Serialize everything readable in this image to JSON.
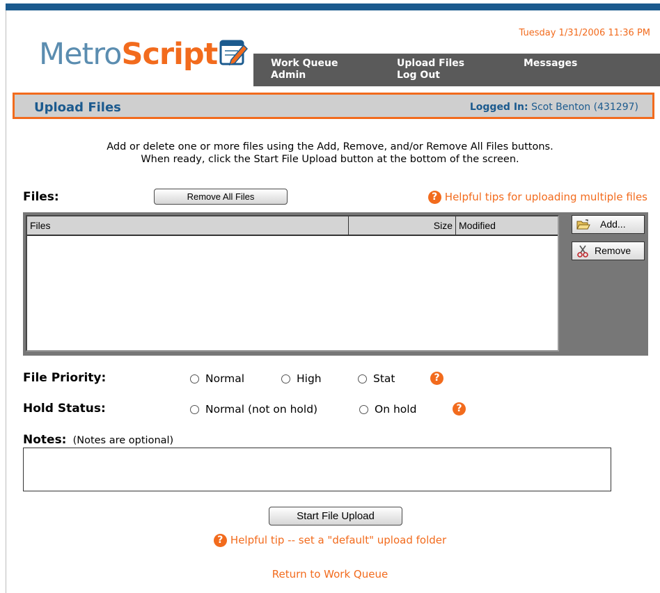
{
  "header": {
    "logo_part1": "Metro",
    "logo_part2": "Script",
    "datetime": "Tuesday 1/31/2006 11:36 PM"
  },
  "nav": {
    "work_queue": "Work Queue",
    "admin": "Admin",
    "upload_files": "Upload Files",
    "log_out": "Log Out",
    "messages": "Messages"
  },
  "page": {
    "title": "Upload Files",
    "logged_in_label": "Logged In:",
    "logged_in_user": "Scot Benton (431297)"
  },
  "instructions": {
    "line1": "Add or delete one or more files using the Add, Remove, and/or Remove All Files buttons.",
    "line2": "When ready, click the Start File Upload button at the bottom of the screen."
  },
  "files": {
    "label": "Files:",
    "remove_all_label": "Remove All Files",
    "tips_link": "Helpful tips for uploading multiple files",
    "columns": {
      "files": "Files",
      "size": "Size",
      "modified": "Modified"
    },
    "add_label": "Add...",
    "remove_label": "Remove"
  },
  "priority": {
    "label": "File Priority:",
    "options": [
      "Normal",
      "High",
      "Stat"
    ]
  },
  "hold": {
    "label": "Hold Status:",
    "options": [
      "Normal (not on hold)",
      "On hold"
    ]
  },
  "notes": {
    "label": "Notes:",
    "hint": "(Notes are optional)"
  },
  "footer": {
    "start_upload": "Start File Upload",
    "tip_link": "Helpful tip -- set a \"default\" upload folder",
    "return_link": "Return to Work Queue"
  },
  "icons": {
    "help": "help-icon",
    "add": "open-folder-icon",
    "remove": "scissors-icon",
    "logo": "notepad-pencil-icon"
  },
  "colors": {
    "brand_orange": "#f26b1d",
    "brand_blue": "#1b5a8e",
    "nav_gray": "#5a5a5a"
  }
}
